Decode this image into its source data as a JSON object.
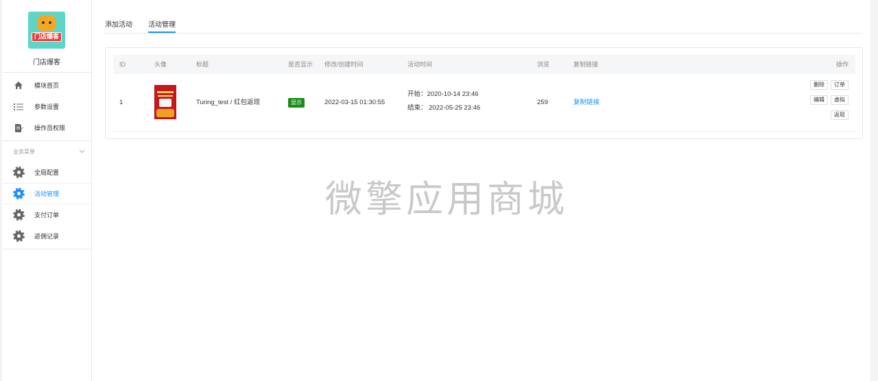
{
  "brand": {
    "logo_text": "门店爆客",
    "name": "门店爆客"
  },
  "sidebar": {
    "main_items": [
      {
        "label": "模块首页",
        "icon": "home-icon"
      },
      {
        "label": "参数设置",
        "icon": "list-icon"
      },
      {
        "label": "操作员权限",
        "icon": "edit-doc-icon"
      }
    ],
    "group_title": "业务菜单",
    "biz_items": [
      {
        "label": "全局配置",
        "icon": "gear-icon"
      },
      {
        "label": "活动管理",
        "icon": "gear-icon",
        "active": true
      },
      {
        "label": "支付订单",
        "icon": "gear-icon"
      },
      {
        "label": "返佣记录",
        "icon": "gear-icon"
      }
    ]
  },
  "tabs": [
    {
      "label": "添加活动"
    },
    {
      "label": "活动管理",
      "active": true
    }
  ],
  "table": {
    "headers": {
      "id": "ID",
      "avatar": "头像",
      "title": "标题",
      "show": "是否显示",
      "modified": "修改/创建时间",
      "period": "活动时间",
      "views": "浏览",
      "copy": "复制链接",
      "ops": "操作"
    },
    "rows": [
      {
        "id": "1",
        "title": "Turing_test / 红包返现",
        "show": "显示",
        "modified": "2022-03-15 01:30:55",
        "start": "开始：2020-10-14 23:46",
        "end": "结束：  2022-05-25 23:46",
        "views": "259",
        "copy_link": "复制链接",
        "actions": {
          "delete": "删除",
          "order": "订单",
          "edit": "编辑",
          "virtual": "虚拟",
          "rebate": "返现"
        }
      }
    ]
  },
  "watermark": "微擎应用商城",
  "colors": {
    "accent": "#1890ff",
    "badge": "#1a8a1a"
  }
}
